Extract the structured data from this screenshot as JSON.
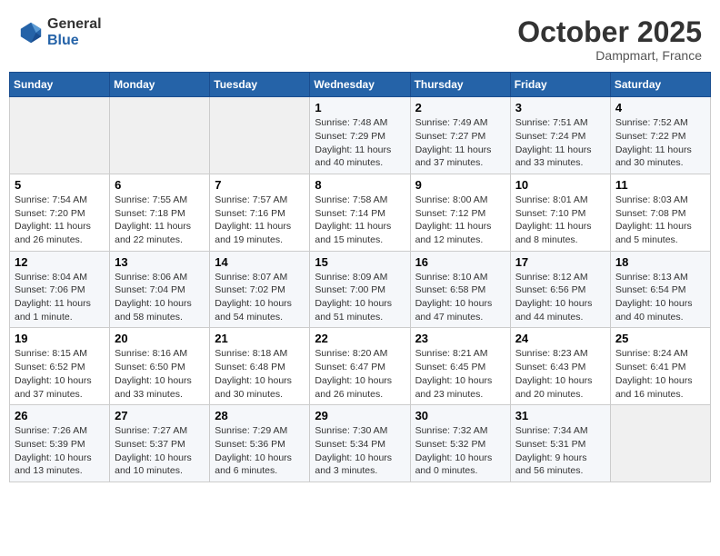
{
  "header": {
    "logo_line1": "General",
    "logo_line2": "Blue",
    "month": "October 2025",
    "location": "Dampmart, France"
  },
  "weekdays": [
    "Sunday",
    "Monday",
    "Tuesday",
    "Wednesday",
    "Thursday",
    "Friday",
    "Saturday"
  ],
  "weeks": [
    [
      {
        "day": "",
        "info": ""
      },
      {
        "day": "",
        "info": ""
      },
      {
        "day": "",
        "info": ""
      },
      {
        "day": "1",
        "info": "Sunrise: 7:48 AM\nSunset: 7:29 PM\nDaylight: 11 hours\nand 40 minutes."
      },
      {
        "day": "2",
        "info": "Sunrise: 7:49 AM\nSunset: 7:27 PM\nDaylight: 11 hours\nand 37 minutes."
      },
      {
        "day": "3",
        "info": "Sunrise: 7:51 AM\nSunset: 7:24 PM\nDaylight: 11 hours\nand 33 minutes."
      },
      {
        "day": "4",
        "info": "Sunrise: 7:52 AM\nSunset: 7:22 PM\nDaylight: 11 hours\nand 30 minutes."
      }
    ],
    [
      {
        "day": "5",
        "info": "Sunrise: 7:54 AM\nSunset: 7:20 PM\nDaylight: 11 hours\nand 26 minutes."
      },
      {
        "day": "6",
        "info": "Sunrise: 7:55 AM\nSunset: 7:18 PM\nDaylight: 11 hours\nand 22 minutes."
      },
      {
        "day": "7",
        "info": "Sunrise: 7:57 AM\nSunset: 7:16 PM\nDaylight: 11 hours\nand 19 minutes."
      },
      {
        "day": "8",
        "info": "Sunrise: 7:58 AM\nSunset: 7:14 PM\nDaylight: 11 hours\nand 15 minutes."
      },
      {
        "day": "9",
        "info": "Sunrise: 8:00 AM\nSunset: 7:12 PM\nDaylight: 11 hours\nand 12 minutes."
      },
      {
        "day": "10",
        "info": "Sunrise: 8:01 AM\nSunset: 7:10 PM\nDaylight: 11 hours\nand 8 minutes."
      },
      {
        "day": "11",
        "info": "Sunrise: 8:03 AM\nSunset: 7:08 PM\nDaylight: 11 hours\nand 5 minutes."
      }
    ],
    [
      {
        "day": "12",
        "info": "Sunrise: 8:04 AM\nSunset: 7:06 PM\nDaylight: 11 hours\nand 1 minute."
      },
      {
        "day": "13",
        "info": "Sunrise: 8:06 AM\nSunset: 7:04 PM\nDaylight: 10 hours\nand 58 minutes."
      },
      {
        "day": "14",
        "info": "Sunrise: 8:07 AM\nSunset: 7:02 PM\nDaylight: 10 hours\nand 54 minutes."
      },
      {
        "day": "15",
        "info": "Sunrise: 8:09 AM\nSunset: 7:00 PM\nDaylight: 10 hours\nand 51 minutes."
      },
      {
        "day": "16",
        "info": "Sunrise: 8:10 AM\nSunset: 6:58 PM\nDaylight: 10 hours\nand 47 minutes."
      },
      {
        "day": "17",
        "info": "Sunrise: 8:12 AM\nSunset: 6:56 PM\nDaylight: 10 hours\nand 44 minutes."
      },
      {
        "day": "18",
        "info": "Sunrise: 8:13 AM\nSunset: 6:54 PM\nDaylight: 10 hours\nand 40 minutes."
      }
    ],
    [
      {
        "day": "19",
        "info": "Sunrise: 8:15 AM\nSunset: 6:52 PM\nDaylight: 10 hours\nand 37 minutes."
      },
      {
        "day": "20",
        "info": "Sunrise: 8:16 AM\nSunset: 6:50 PM\nDaylight: 10 hours\nand 33 minutes."
      },
      {
        "day": "21",
        "info": "Sunrise: 8:18 AM\nSunset: 6:48 PM\nDaylight: 10 hours\nand 30 minutes."
      },
      {
        "day": "22",
        "info": "Sunrise: 8:20 AM\nSunset: 6:47 PM\nDaylight: 10 hours\nand 26 minutes."
      },
      {
        "day": "23",
        "info": "Sunrise: 8:21 AM\nSunset: 6:45 PM\nDaylight: 10 hours\nand 23 minutes."
      },
      {
        "day": "24",
        "info": "Sunrise: 8:23 AM\nSunset: 6:43 PM\nDaylight: 10 hours\nand 20 minutes."
      },
      {
        "day": "25",
        "info": "Sunrise: 8:24 AM\nSunset: 6:41 PM\nDaylight: 10 hours\nand 16 minutes."
      }
    ],
    [
      {
        "day": "26",
        "info": "Sunrise: 7:26 AM\nSunset: 5:39 PM\nDaylight: 10 hours\nand 13 minutes."
      },
      {
        "day": "27",
        "info": "Sunrise: 7:27 AM\nSunset: 5:37 PM\nDaylight: 10 hours\nand 10 minutes."
      },
      {
        "day": "28",
        "info": "Sunrise: 7:29 AM\nSunset: 5:36 PM\nDaylight: 10 hours\nand 6 minutes."
      },
      {
        "day": "29",
        "info": "Sunrise: 7:30 AM\nSunset: 5:34 PM\nDaylight: 10 hours\nand 3 minutes."
      },
      {
        "day": "30",
        "info": "Sunrise: 7:32 AM\nSunset: 5:32 PM\nDaylight: 10 hours\nand 0 minutes."
      },
      {
        "day": "31",
        "info": "Sunrise: 7:34 AM\nSunset: 5:31 PM\nDaylight: 9 hours\nand 56 minutes."
      },
      {
        "day": "",
        "info": ""
      }
    ]
  ]
}
